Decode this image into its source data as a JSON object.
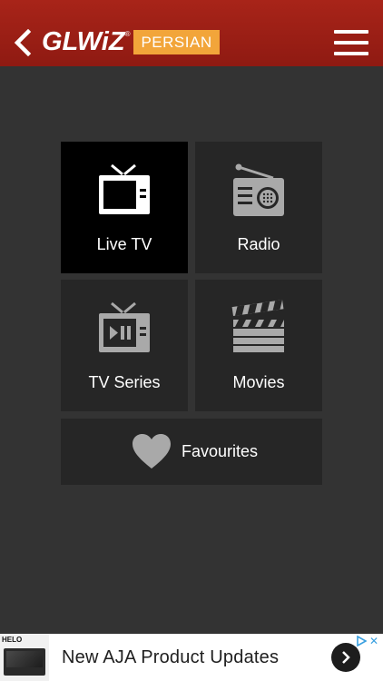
{
  "header": {
    "logo_text": "GLWiZ",
    "logo_registered": "®",
    "language_badge": "PERSIAN"
  },
  "tiles": [
    {
      "label": "Live TV",
      "icon": "tv-icon",
      "active": true
    },
    {
      "label": "Radio",
      "icon": "radio-icon",
      "active": false
    },
    {
      "label": "TV Series",
      "icon": "tv-series-icon",
      "active": false
    },
    {
      "label": "Movies",
      "icon": "clapperboard-icon",
      "active": false
    }
  ],
  "favourites": {
    "label": "Favourites",
    "icon": "heart-icon"
  },
  "ad": {
    "brand": "HELO",
    "title": "New AJA Product Updates",
    "icons": [
      "adchoices-icon",
      "close-icon",
      "chevron-right-icon"
    ]
  },
  "colors": {
    "header_bg": "#9c1f15",
    "badge_bg": "#f2a53a",
    "background": "#333333",
    "tile_bg": "#262626",
    "tile_active_bg": "#000000",
    "icon_gray": "#a9a9a9"
  }
}
